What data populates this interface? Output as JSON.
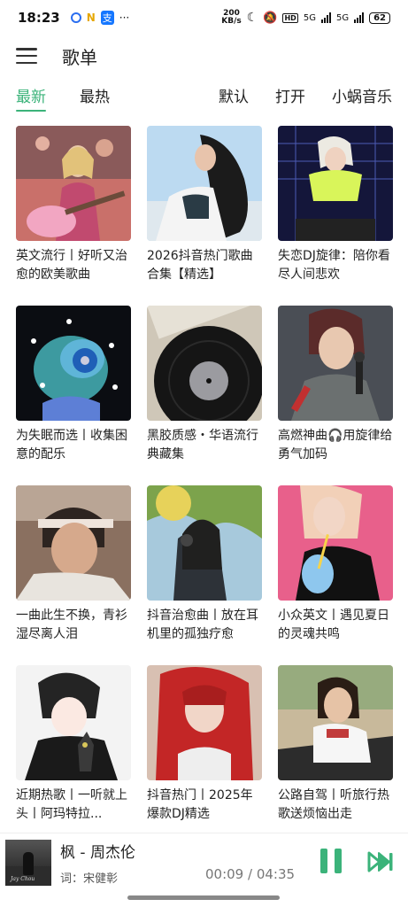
{
  "status_bar": {
    "time": "18:23",
    "dots": "···",
    "speed_value": "200",
    "speed_unit": "KB/s",
    "hd": "HD",
    "net1": "5G",
    "net2": "5G",
    "battery": "62"
  },
  "header": {
    "title": "歌单"
  },
  "tabs": {
    "latest": "最新",
    "hottest": "最热",
    "default": "默认",
    "open": "打开",
    "source": "小蜗音乐"
  },
  "playlists": [
    {
      "title": "英文流行丨好听又治愈的欧美歌曲"
    },
    {
      "title": "2026抖音热门歌曲合集【精选】"
    },
    {
      "title": "失恋DJ旋律：陪你看尽人间悲欢"
    },
    {
      "title": "为失眠而选丨收集困意的配乐"
    },
    {
      "title": "黑胶质感・华语流行典藏集"
    },
    {
      "title": "高燃神曲🎧用旋律给勇气加码"
    },
    {
      "title": "一曲此生不换，青衫湿尽离人泪"
    },
    {
      "title": "抖音治愈曲丨放在耳机里的孤独疗愈"
    },
    {
      "title": "小众英文丨遇见夏日的灵魂共鸣"
    },
    {
      "title": "近期热歌丨一听就上头丨阿玛特拉..."
    },
    {
      "title": "抖音热门丨2025年爆款DJ精选"
    },
    {
      "title": "公路自驾丨听旅行热歌送烦恼出走"
    }
  ],
  "player": {
    "song": "枫 - 周杰伦",
    "lyric": "词：宋健彰",
    "current_time": "00:09",
    "separator": " / ",
    "total_time": "04:35",
    "album_signature": "Jay Chou"
  },
  "colors": {
    "accent": "#3bb37a"
  }
}
